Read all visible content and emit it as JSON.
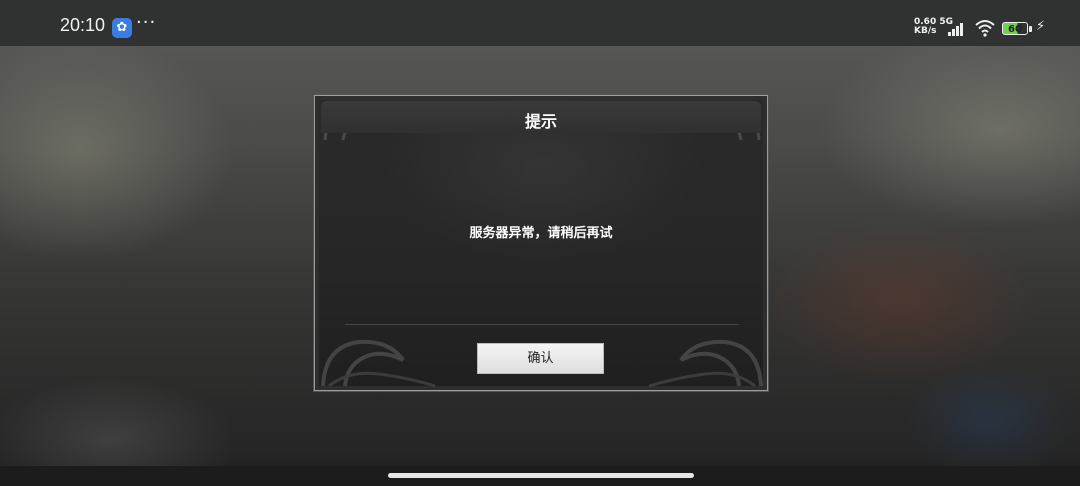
{
  "status_bar": {
    "time": "20:10",
    "more_indicator": "···",
    "net_speed_value": "0.60",
    "net_speed_unit": "KB/s",
    "network_type": "5G",
    "battery_level": "60",
    "icons": [
      "app-notification-icon",
      "signal-icon",
      "wifi-icon",
      "battery-icon",
      "charging-icon"
    ]
  },
  "dialog": {
    "title": "提示",
    "message": "服务器异常，请稍后再试",
    "confirm_label": "确认"
  },
  "colors": {
    "battery_fill": "#6ed14a",
    "dialog_bg": "#262626",
    "button_bg": "#ececec"
  }
}
